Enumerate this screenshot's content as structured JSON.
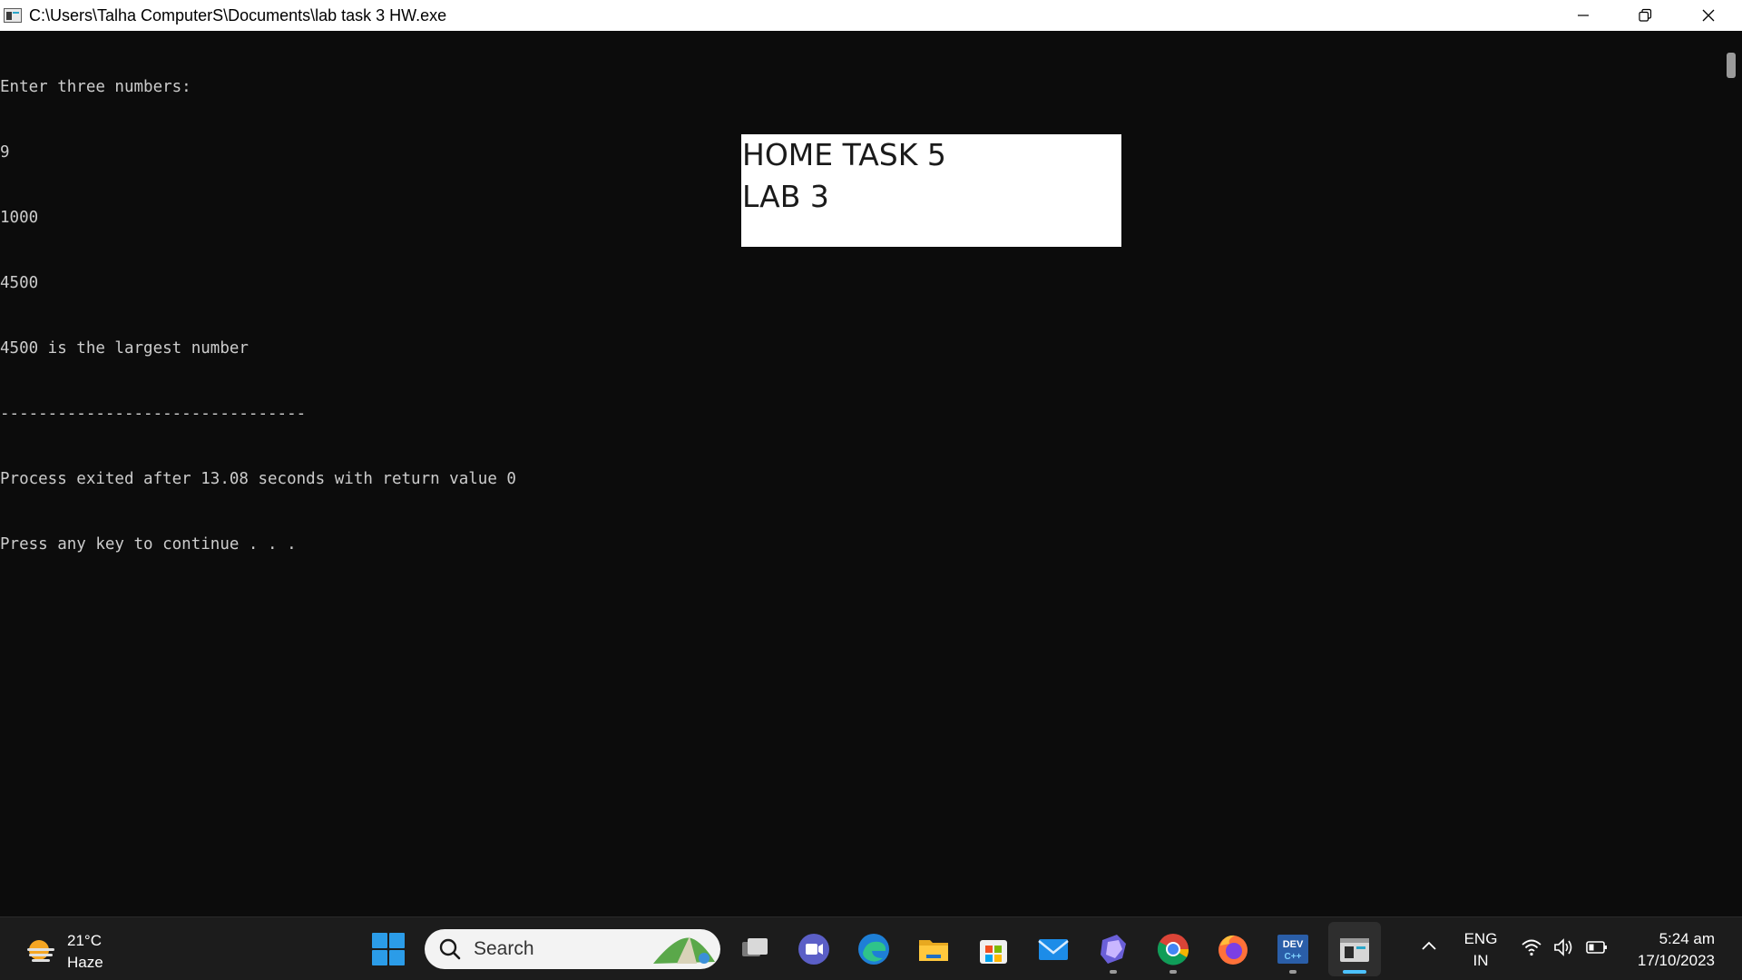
{
  "window": {
    "title": "C:\\Users\\Talha ComputerS\\Documents\\lab task 3 HW.exe"
  },
  "console": {
    "lines": [
      "Enter three numbers:",
      "9",
      "1000",
      "4500",
      "4500 is the largest number",
      "--------------------------------",
      "Process exited after 13.08 seconds with return value 0",
      "Press any key to continue . . ."
    ]
  },
  "note": {
    "line1": "HOME TASK 5",
    "line2": "LAB 3"
  },
  "taskbar": {
    "weather_temp": "21°C",
    "weather_desc": "Haze",
    "search_placeholder": "Search",
    "apps": [
      "task-view-icon",
      "meet-icon",
      "edge-icon",
      "file-explorer-icon",
      "microsoft-store-icon",
      "mail-icon",
      "copilot-icon",
      "chrome-icon",
      "firefox-icon",
      "dev-cpp-icon",
      "console-app-icon"
    ],
    "lang_line1": "ENG",
    "lang_line2": "IN",
    "time": "5:24 am",
    "date": "17/10/2023",
    "dev_icon_label": "DEV",
    "dev_icon_sublabel": "C++"
  },
  "colors": {
    "console_bg": "#0c0c0c",
    "console_text": "#cccccc",
    "taskbar_bg": "#1c1c1c",
    "accent": "#4cc2ff"
  }
}
